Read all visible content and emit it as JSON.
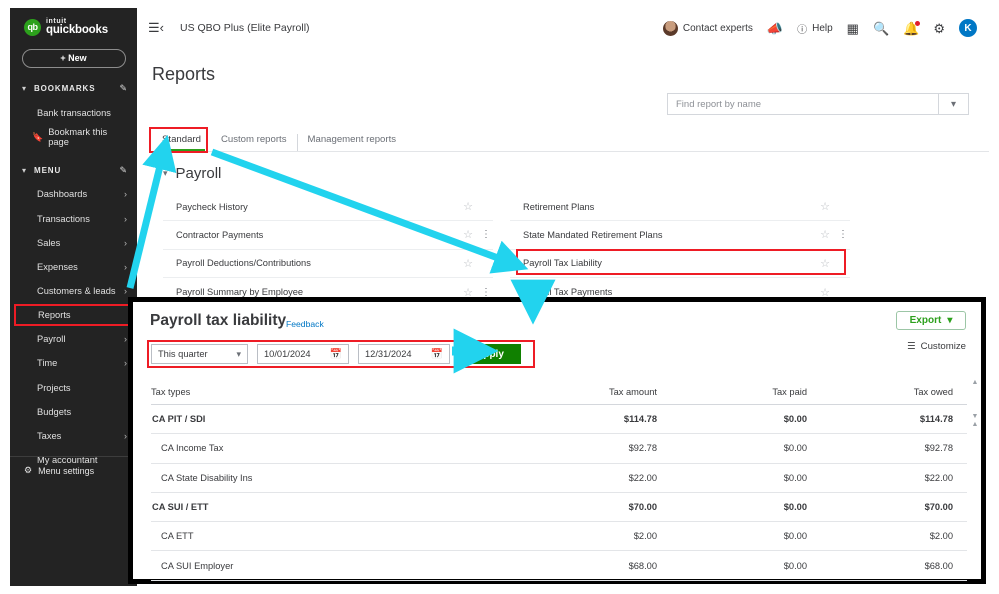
{
  "colors": {
    "brand_green": "#2ca01c",
    "apply_green": "#108000",
    "annotation_red": "#ee1c25",
    "annotation_cyan": "#22d3ee",
    "link_blue": "#0077c5",
    "sidebar_bg": "#232323"
  },
  "sidebar": {
    "brand_intuit": "intuit",
    "brand_name": "quickbooks",
    "logo_glyph": "qb",
    "new_button": "+  New",
    "bookmarks_label": "BOOKMARKS",
    "menu_label": "MENU",
    "bookmarks": [
      {
        "label": "Bank transactions",
        "icon": null,
        "arrow": false
      },
      {
        "label": "Bookmark this page",
        "icon": "bookmark-icon",
        "arrow": false
      }
    ],
    "menu_items": [
      {
        "label": "Dashboards",
        "arrow": true,
        "highlighted": false
      },
      {
        "label": "Transactions",
        "arrow": true,
        "highlighted": false
      },
      {
        "label": "Sales",
        "arrow": true,
        "highlighted": false
      },
      {
        "label": "Expenses",
        "arrow": true,
        "highlighted": false
      },
      {
        "label": "Customers & leads",
        "arrow": true,
        "highlighted": false
      },
      {
        "label": "Reports",
        "arrow": false,
        "highlighted": true
      },
      {
        "label": "Payroll",
        "arrow": true,
        "highlighted": false
      },
      {
        "label": "Time",
        "arrow": true,
        "highlighted": false
      },
      {
        "label": "Projects",
        "arrow": false,
        "highlighted": false
      },
      {
        "label": "Budgets",
        "arrow": false,
        "highlighted": false
      },
      {
        "label": "Taxes",
        "arrow": true,
        "highlighted": false
      },
      {
        "label": "My accountant",
        "arrow": false,
        "highlighted": false
      }
    ],
    "menu_settings": "Menu settings"
  },
  "topbar": {
    "hamburger_icon": "hamburger-icon",
    "company": "US QBO Plus (Elite Payroll)",
    "contact_experts": "Contact experts",
    "megaphone_icon": "megaphone-icon",
    "help_label": "Help",
    "help_icon": "question-circle-icon",
    "grid_icon": "app-grid-icon",
    "search_icon": "search-icon",
    "bell_icon": "bell-icon",
    "gear_icon": "gear-icon",
    "user_initial": "K"
  },
  "page": {
    "title": "Reports",
    "search_placeholder": "Find report by name",
    "search_value": "",
    "tabs": [
      {
        "label": "Standard",
        "active": true
      },
      {
        "label": "Custom reports",
        "active": false
      },
      {
        "label": "Management reports",
        "active": false
      }
    ]
  },
  "payroll_section": {
    "heading": "Payroll",
    "left_reports": [
      {
        "label": "Paycheck History",
        "kebab": false
      },
      {
        "label": "Contractor Payments",
        "kebab": true
      },
      {
        "label": "Payroll Deductions/Contributions",
        "kebab": false
      },
      {
        "label": "Payroll Summary by Employee",
        "kebab": true
      }
    ],
    "right_reports": [
      {
        "label": "Retirement Plans",
        "kebab": false
      },
      {
        "label": "State Mandated Retirement Plans",
        "kebab": true
      },
      {
        "label": "Payroll Tax Liability",
        "kebab": false
      },
      {
        "label": "Payroll Tax Payments",
        "kebab": false
      }
    ]
  },
  "report_panel": {
    "title": "Payroll tax liability",
    "feedback_link": "Feedback",
    "export_label": "Export",
    "customize_label": "Customize",
    "period_value": "This quarter",
    "start_date": "10/01/2024",
    "end_date": "12/31/2024",
    "apply_label": "Apply",
    "table": {
      "columns": [
        "Tax types",
        "Tax amount",
        "Tax paid",
        "Tax owed"
      ],
      "rows": [
        {
          "type": "CA PIT / SDI",
          "amount": "$114.78",
          "paid": "$0.00",
          "owed": "$114.78",
          "level": 0
        },
        {
          "type": "CA Income Tax",
          "amount": "$92.78",
          "paid": "$0.00",
          "owed": "$92.78",
          "level": 1
        },
        {
          "type": "CA State Disability Ins",
          "amount": "$22.00",
          "paid": "$0.00",
          "owed": "$22.00",
          "level": 1
        },
        {
          "type": "CA SUI / ETT",
          "amount": "$70.00",
          "paid": "$0.00",
          "owed": "$70.00",
          "level": 0
        },
        {
          "type": "CA ETT",
          "amount": "$2.00",
          "paid": "$0.00",
          "owed": "$2.00",
          "level": 1
        },
        {
          "type": "CA SUI Employer",
          "amount": "$68.00",
          "paid": "$0.00",
          "owed": "$68.00",
          "level": 1
        }
      ]
    }
  }
}
